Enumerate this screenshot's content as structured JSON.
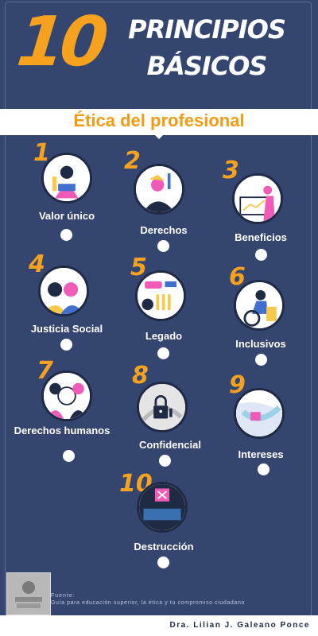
{
  "header": {
    "number": "10",
    "title_line1": "PRINCIPIOS",
    "title_line2": "BÁSICOS"
  },
  "banner": {
    "text": "Ética del profesional"
  },
  "principles": [
    {
      "number": "1",
      "label": "Valor único"
    },
    {
      "number": "2",
      "label": "Derechos"
    },
    {
      "number": "3",
      "label": "Beneficios"
    },
    {
      "number": "4",
      "label": "Justicia Social"
    },
    {
      "number": "5",
      "label": "Legado"
    },
    {
      "number": "6",
      "label": "Inclusivos"
    },
    {
      "number": "7",
      "label": "Derechos humanos"
    },
    {
      "number": "8",
      "label": "Confidencial"
    },
    {
      "number": "9",
      "label": "Intereses"
    },
    {
      "number": "10",
      "label": "Destrucción"
    }
  ],
  "footer": {
    "source_label": "Fuente:",
    "source_text": "Guía para educación superior, la ética y tu compromiso ciudadano",
    "author": "Dra. Lilian J. Galeano Ponce"
  },
  "colors": {
    "background": "#34456f",
    "accent_orange": "#f6a21e",
    "banner_text": "#f39c12",
    "white": "#ffffff",
    "illustration_pink": "#f05bb8",
    "illustration_dark": "#1f2a44",
    "illustration_blue": "#3f6fcf",
    "illustration_yellow": "#f7c948"
  }
}
